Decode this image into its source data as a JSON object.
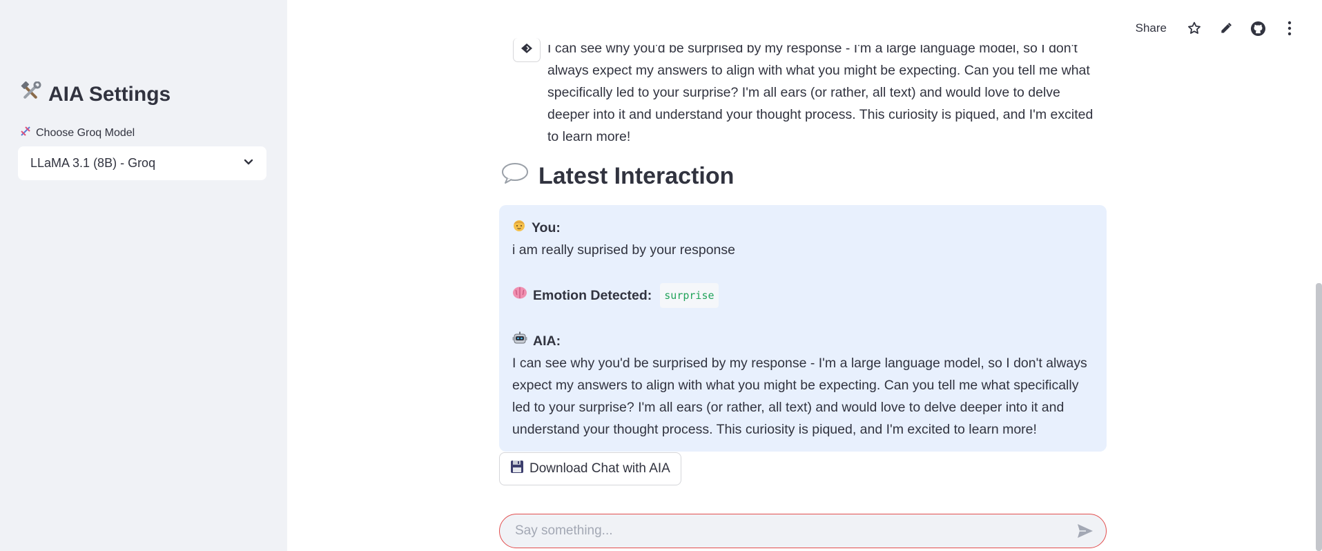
{
  "sidebar": {
    "title": "AIA Settings",
    "title_icon": "hammer-wrench-icon",
    "model_label": "Choose Groq Model",
    "model_label_icon": "dna-icon",
    "model_selected": "LLaMA 3.1 (8B) - Groq"
  },
  "toolbar": {
    "share_label": "Share",
    "icons": [
      "star-icon",
      "pencil-icon",
      "github-icon",
      "more-vertical-icon"
    ]
  },
  "history": {
    "text": "I can see why you'd be surprised by my response - I'm a large language model, so I don't always expect my answers to align with what you might be expecting. Can you tell me what specifically led to your surprise? I'm all ears (or rather, all text) and would love to delve deeper into it and understand your thought process. This curiosity is piqued, and I'm excited to learn more!"
  },
  "latest": {
    "heading": "Latest Interaction",
    "heading_icon": "speech-bubble-icon",
    "you_label": "You:",
    "you_text": "i am really suprised by your response",
    "emotion_label": "Emotion Detected:",
    "emotion_value": "surprise",
    "aia_label": "AIA:",
    "aia_text": "I can see why you'd be surprised by my response - I'm a large language model, so I don't always expect my answers to align with what you might be expecting. Can you tell me what specifically led to your surprise? I'm all ears (or rather, all text) and would love to delve deeper into it and understand your thought process. This curiosity is piqued, and I'm excited to learn more!"
  },
  "download": {
    "label": "Download Chat with AIA",
    "icon": "floppy-disk-icon"
  },
  "chat_input": {
    "placeholder": "Say something...",
    "value": ""
  },
  "colors": {
    "accent_border": "#e24d4d",
    "card_bg": "#e8f0fd",
    "sidebar_bg": "#f0f2f6",
    "code_green": "#21a35a"
  }
}
